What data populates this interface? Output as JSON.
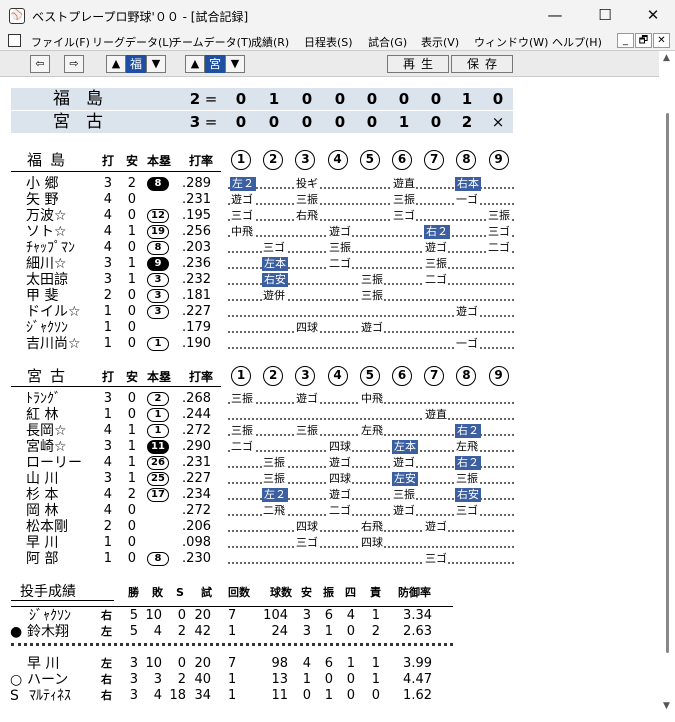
{
  "window": {
    "title": "ベストプレープロ野球'００ - [試合記録]",
    "app_icon": "baseball-app-icon",
    "min": "—",
    "max": "☐",
    "close": "✕"
  },
  "menubar": {
    "items": [
      "ファイル(F)",
      "リーグデータ(L)",
      "チームデータ(T)",
      "成績(R)",
      "日程表(S)",
      "試合(G)",
      "表示(V)",
      "ウィンドウ(W)",
      "ヘルプ(H)"
    ],
    "mdi": [
      "_",
      "🗗",
      "✕"
    ]
  },
  "toolbar": {
    "prev": "⇦",
    "next": "⇨",
    "team1": "福",
    "team2": "宮",
    "play": "再生",
    "save": "保存"
  },
  "scoreboard": [
    {
      "team": "福島",
      "total": "2",
      "eq": "=",
      "innings": [
        "0",
        "1",
        "0",
        "0",
        "0",
        "0",
        "0",
        "1",
        "0"
      ]
    },
    {
      "team": "宮古",
      "total": "3",
      "eq": "=",
      "innings": [
        "0",
        "0",
        "0",
        "0",
        "0",
        "1",
        "0",
        "2",
        "×"
      ]
    }
  ],
  "headers": {
    "ab": "打",
    "hit": "安",
    "hr": "本塁",
    "avg": "打率",
    "innings": [
      "1",
      "2",
      "3",
      "4",
      "5",
      "6",
      "7",
      "8",
      "9"
    ]
  },
  "batting": [
    {
      "team": "福島",
      "players": [
        {
          "name": "小 郷",
          "ab": "3",
          "h": "2",
          "hr": "8",
          "hrfill": true,
          "avg": ".289",
          "cells": [
            [
              0,
              "左２",
              true
            ],
            [
              2,
              "投ギ",
              false
            ],
            [
              5,
              "遊直",
              false
            ],
            [
              7,
              "右本",
              true
            ]
          ]
        },
        {
          "name": "矢 野",
          "ab": "4",
          "h": "0",
          "hr": "",
          "avg": ".231",
          "cells": [
            [
              0,
              "遊ゴ",
              false
            ],
            [
              2,
              "三振",
              false
            ],
            [
              5,
              "三振",
              false
            ],
            [
              7,
              "一ゴ",
              false
            ]
          ]
        },
        {
          "name": "万波☆",
          "ab": "4",
          "h": "0",
          "hr": "12",
          "avg": ".195",
          "cells": [
            [
              0,
              "三ゴ",
              false
            ],
            [
              2,
              "右飛",
              false
            ],
            [
              5,
              "三ゴ",
              false
            ],
            [
              8,
              "三振",
              false
            ]
          ]
        },
        {
          "name": "ソト☆",
          "ab": "4",
          "h": "1",
          "hr": "19",
          "avg": ".256",
          "cells": [
            [
              0,
              "中飛",
              false
            ],
            [
              3,
              "遊ゴ",
              false
            ],
            [
              6,
              "右２",
              true
            ],
            [
              8,
              "三ゴ",
              false
            ]
          ]
        },
        {
          "name": "ﾁｬｯﾌﾟﾏﾝ",
          "ab": "4",
          "h": "0",
          "hr": "8",
          "avg": ".203",
          "cells": [
            [
              1,
              "三ゴ",
              false
            ],
            [
              3,
              "三振",
              false
            ],
            [
              6,
              "遊ゴ",
              false
            ],
            [
              8,
              "二ゴ",
              false
            ]
          ]
        },
        {
          "name": "細川☆",
          "ab": "3",
          "h": "1",
          "hr": "9",
          "hrfill": true,
          "avg": ".236",
          "cells": [
            [
              1,
              "左本",
              true
            ],
            [
              3,
              "二ゴ",
              false
            ],
            [
              6,
              "三振",
              false
            ]
          ]
        },
        {
          "name": "太田諒",
          "ab": "3",
          "h": "1",
          "hr": "3",
          "avg": ".232",
          "cells": [
            [
              1,
              "右安",
              true
            ],
            [
              4,
              "三振",
              false
            ],
            [
              6,
              "二ゴ",
              false
            ]
          ]
        },
        {
          "name": "甲 斐",
          "ab": "2",
          "h": "0",
          "hr": "3",
          "avg": ".181",
          "cells": [
            [
              1,
              "遊併",
              false
            ],
            [
              4,
              "三振",
              false
            ]
          ]
        },
        {
          "name": "ドイル☆",
          "ab": "1",
          "h": "0",
          "hr": "3",
          "avg": ".227",
          "cells": [
            [
              7,
              "遊ゴ",
              false
            ]
          ]
        },
        {
          "name": "ｼﾞｬｸｿﾝ",
          "ab": "1",
          "h": "0",
          "hr": "",
          "avg": ".179",
          "cells": [
            [
              2,
              "四球",
              false
            ],
            [
              4,
              "遊ゴ",
              false
            ]
          ]
        },
        {
          "name": "吉川尚☆",
          "ab": "1",
          "h": "0",
          "hr": "1",
          "avg": ".190",
          "cells": [
            [
              7,
              "一ゴ",
              false
            ]
          ]
        }
      ]
    },
    {
      "team": "宮古",
      "players": [
        {
          "name": "ﾄﾗﾝｸﾞ",
          "ab": "3",
          "h": "0",
          "hr": "2",
          "avg": ".268",
          "cells": [
            [
              0,
              "三振",
              false
            ],
            [
              2,
              "遊ゴ",
              false
            ],
            [
              4,
              "中飛",
              false
            ]
          ]
        },
        {
          "name": "紅 林",
          "ab": "1",
          "h": "0",
          "hr": "1",
          "avg": ".244",
          "cells": [
            [
              6,
              "遊直",
              false
            ]
          ]
        },
        {
          "name": "長岡☆",
          "ab": "4",
          "h": "1",
          "hr": "1",
          "avg": ".272",
          "cells": [
            [
              0,
              "三振",
              false
            ],
            [
              2,
              "三振",
              false
            ],
            [
              4,
              "左飛",
              false
            ],
            [
              7,
              "右２",
              true
            ]
          ]
        },
        {
          "name": "宮崎☆",
          "ab": "3",
          "h": "1",
          "hr": "11",
          "hrfill": true,
          "avg": ".290",
          "cells": [
            [
              0,
              "二ゴ",
              false
            ],
            [
              3,
              "四球",
              false
            ],
            [
              5,
              "左本",
              true
            ],
            [
              7,
              "左飛",
              false
            ]
          ]
        },
        {
          "name": "ローリー",
          "ab": "4",
          "h": "1",
          "hr": "26",
          "avg": ".231",
          "cells": [
            [
              1,
              "三振",
              false
            ],
            [
              3,
              "遊ゴ",
              false
            ],
            [
              5,
              "遊ゴ",
              false
            ],
            [
              7,
              "右２",
              true
            ]
          ]
        },
        {
          "name": "山 川",
          "ab": "3",
          "h": "1",
          "hr": "25",
          "avg": ".227",
          "cells": [
            [
              1,
              "三振",
              false
            ],
            [
              3,
              "四球",
              false
            ],
            [
              5,
              "左安",
              true
            ],
            [
              7,
              "三振",
              false
            ]
          ]
        },
        {
          "name": "杉 本",
          "ab": "4",
          "h": "2",
          "hr": "17",
          "avg": ".234",
          "cells": [
            [
              1,
              "左２",
              true
            ],
            [
              3,
              "遊ゴ",
              false
            ],
            [
              5,
              "三振",
              false
            ],
            [
              7,
              "右安",
              true
            ]
          ]
        },
        {
          "name": "岡 林",
          "ab": "4",
          "h": "0",
          "hr": "",
          "avg": ".272",
          "cells": [
            [
              1,
              "二飛",
              false
            ],
            [
              3,
              "二ゴ",
              false
            ],
            [
              5,
              "遊ゴ",
              false
            ],
            [
              7,
              "三ゴ",
              false
            ]
          ]
        },
        {
          "name": "松本剛",
          "ab": "2",
          "h": "0",
          "hr": "",
          "avg": ".206",
          "cells": [
            [
              2,
              "四球",
              false
            ],
            [
              4,
              "右飛",
              false
            ],
            [
              6,
              "遊ゴ",
              false
            ]
          ]
        },
        {
          "name": "早 川",
          "ab": "1",
          "h": "0",
          "hr": "",
          "avg": ".098",
          "cells": [
            [
              2,
              "三ゴ",
              false
            ],
            [
              4,
              "四球",
              false
            ]
          ]
        },
        {
          "name": "阿 部",
          "ab": "1",
          "h": "0",
          "hr": "8",
          "avg": ".230",
          "cells": [
            [
              6,
              "三ゴ",
              false
            ]
          ]
        }
      ]
    }
  ],
  "pitching": {
    "title": "投手成績",
    "headers": [
      "勝",
      "敗",
      "S",
      "試",
      "回数",
      "球数",
      "安",
      "振",
      "四",
      "責",
      "防御率"
    ],
    "groups": [
      [
        {
          "mark": "",
          "name": "ｼﾞｬｸｿﾝ",
          "hand": "右",
          "stats": [
            "5",
            "10",
            "0",
            "20",
            "7",
            "104",
            "3",
            "6",
            "4",
            "1",
            "3.34"
          ]
        },
        {
          "mark": "●",
          "name": "鈴木翔",
          "hand": "左",
          "stats": [
            "5",
            "4",
            "2",
            "42",
            "1",
            "24",
            "3",
            "1",
            "0",
            "2",
            "2.63"
          ]
        }
      ],
      [
        {
          "mark": "",
          "name": "早 川",
          "hand": "左",
          "stats": [
            "3",
            "10",
            "0",
            "20",
            "7",
            "98",
            "4",
            "6",
            "1",
            "1",
            "3.99"
          ]
        },
        {
          "mark": "○",
          "name": "ハーン",
          "hand": "右",
          "stats": [
            "3",
            "3",
            "2",
            "40",
            "1",
            "13",
            "1",
            "0",
            "0",
            "1",
            "4.47"
          ]
        },
        {
          "mark": "S",
          "name": "ﾏﾙﾃｨﾈｽ",
          "hand": "右",
          "stats": [
            "3",
            "4",
            "18",
            "34",
            "1",
            "11",
            "0",
            "1",
            "0",
            "0",
            "1.62"
          ]
        }
      ]
    ]
  }
}
